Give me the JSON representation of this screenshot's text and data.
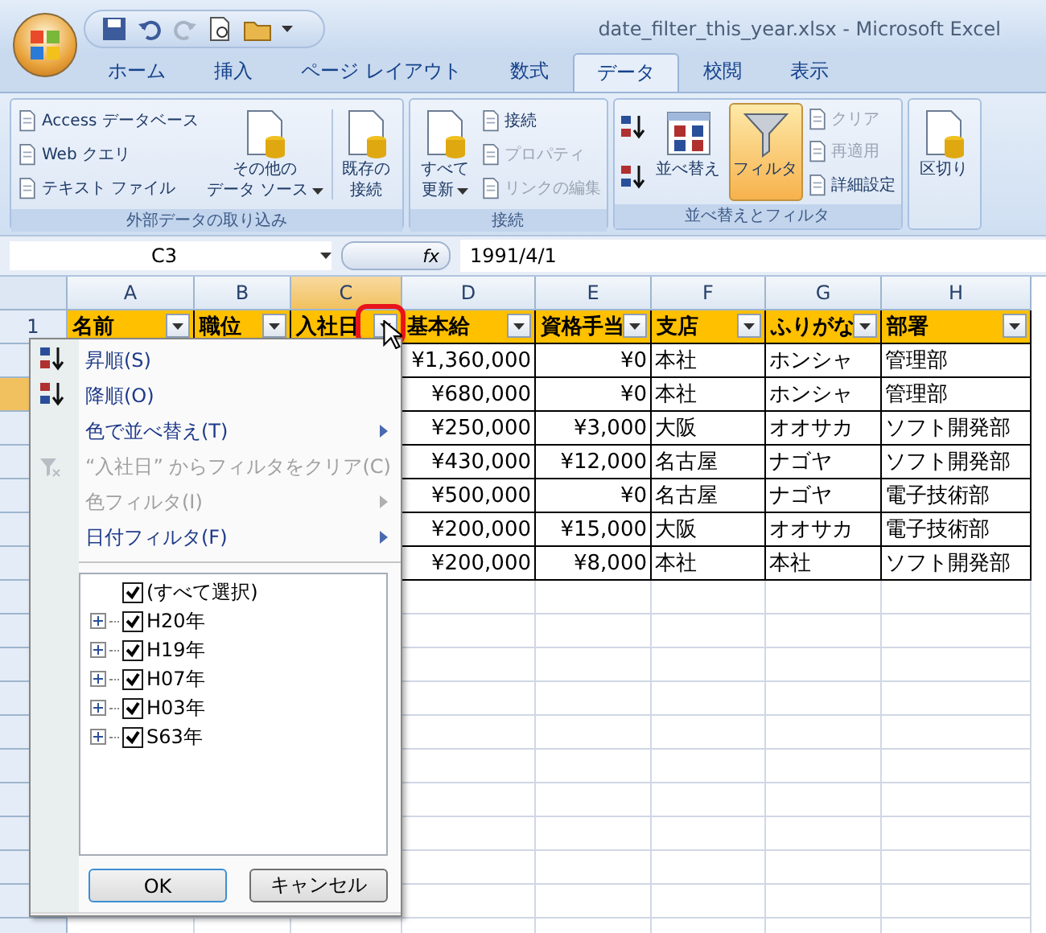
{
  "window": {
    "title": "date_filter_this_year.xlsx - Microsoft Excel"
  },
  "tabs": [
    {
      "label": "ホーム",
      "selected": false
    },
    {
      "label": "挿入",
      "selected": false
    },
    {
      "label": "ページ レイアウト",
      "selected": false
    },
    {
      "label": "数式",
      "selected": false
    },
    {
      "label": "データ",
      "selected": true
    },
    {
      "label": "校閲",
      "selected": false
    },
    {
      "label": "表示",
      "selected": false
    }
  ],
  "ribbon": {
    "groups": [
      {
        "label": "外部データの取り込み",
        "columns": [
          {
            "kind": "stack",
            "items": [
              {
                "label": "Access データベース",
                "disabled": false
              },
              {
                "label": "Web クエリ",
                "disabled": false
              },
              {
                "label": "テキスト ファイル",
                "disabled": false
              }
            ]
          },
          {
            "kind": "large",
            "lines": [
              "その他の",
              "データ ソース"
            ],
            "dropdown": true,
            "pressed": false
          },
          {
            "kind": "separator"
          },
          {
            "kind": "large",
            "lines": [
              "既存の",
              "接続"
            ],
            "dropdown": false,
            "pressed": false
          }
        ]
      },
      {
        "label": "接続",
        "columns": [
          {
            "kind": "large",
            "lines": [
              "すべて",
              "更新"
            ],
            "dropdown": true,
            "pressed": false
          },
          {
            "kind": "stack",
            "items": [
              {
                "label": "接続",
                "disabled": false
              },
              {
                "label": "プロパティ",
                "disabled": true
              },
              {
                "label": "リンクの編集",
                "disabled": true
              }
            ]
          }
        ]
      },
      {
        "label": "並べ替えとフィルタ",
        "columns": [
          {
            "kind": "sorticons"
          },
          {
            "kind": "large",
            "lines": [
              "並べ替え"
            ],
            "dropdown": false,
            "pressed": false
          },
          {
            "kind": "large",
            "lines": [
              "フィルタ"
            ],
            "dropdown": false,
            "pressed": true
          },
          {
            "kind": "stack",
            "items": [
              {
                "label": "クリア",
                "disabled": true
              },
              {
                "label": "再適用",
                "disabled": true
              },
              {
                "label": "詳細設定",
                "disabled": false
              }
            ]
          }
        ]
      },
      {
        "columns": [
          {
            "kind": "large",
            "lines": [
              "区切り"
            ],
            "dropdown": false,
            "pressed": false
          }
        ]
      }
    ]
  },
  "formula_bar": {
    "name_box": "C3",
    "function_label": "fx",
    "value": "1991/4/1"
  },
  "sheet": {
    "columns": [
      {
        "label": "A",
        "selected": false
      },
      {
        "label": "B",
        "selected": false
      },
      {
        "label": "C",
        "selected": true
      },
      {
        "label": "D",
        "selected": false
      },
      {
        "label": "E",
        "selected": false
      },
      {
        "label": "F",
        "selected": false
      },
      {
        "label": "G",
        "selected": false
      },
      {
        "label": "H",
        "selected": false
      }
    ],
    "header_row": {
      "number": "1",
      "cells": [
        "名前",
        "職位",
        "入社日",
        "基本給",
        "資格手当",
        "支店",
        "ふりがな",
        "部署"
      ]
    },
    "rows": [
      {
        "selected": false,
        "cells": [
          "",
          "",
          "",
          "¥1,360,000",
          "¥0",
          "本社",
          "ホンシャ",
          "管理部"
        ]
      },
      {
        "selected": true,
        "cells": [
          "",
          "",
          "",
          "¥680,000",
          "¥0",
          "本社",
          "ホンシャ",
          "管理部"
        ]
      },
      {
        "selected": false,
        "cells": [
          "",
          "",
          "",
          "¥250,000",
          "¥3,000",
          "大阪",
          "オオサカ",
          "ソフト開発部"
        ]
      },
      {
        "selected": false,
        "cells": [
          "",
          "",
          "",
          "¥430,000",
          "¥12,000",
          "名古屋",
          "ナゴヤ",
          "ソフト開発部"
        ]
      },
      {
        "selected": false,
        "cells": [
          "",
          "",
          "",
          "¥500,000",
          "¥0",
          "名古屋",
          "ナゴヤ",
          "電子技術部"
        ]
      },
      {
        "selected": false,
        "cells": [
          "",
          "",
          "",
          "¥200,000",
          "¥15,000",
          "大阪",
          "オオサカ",
          "電子技術部"
        ]
      },
      {
        "selected": false,
        "cells": [
          "",
          "",
          "",
          "¥200,000",
          "¥8,000",
          "本社",
          "本社",
          "ソフト開発部"
        ]
      }
    ]
  },
  "filter_menu": {
    "items": [
      {
        "kind": "sort-asc",
        "label": "昇順(S)",
        "disabled": false,
        "submenu": false
      },
      {
        "kind": "sort-desc",
        "label": "降順(O)",
        "disabled": false,
        "submenu": false
      },
      {
        "kind": "plain",
        "label": "色で並べ替え(T)",
        "disabled": false,
        "submenu": true
      },
      {
        "kind": "clear",
        "label": "“入社日” からフィルタをクリア(C)",
        "disabled": true,
        "submenu": false
      },
      {
        "kind": "plain",
        "label": "色フィルタ(I)",
        "disabled": true,
        "submenu": true
      },
      {
        "kind": "plain",
        "label": "日付フィルタ(F)",
        "disabled": false,
        "submenu": true
      }
    ],
    "tree": {
      "label": "(すべて選択)",
      "checked": true,
      "children": [
        {
          "label": "H20年",
          "checked": true,
          "expanded": false
        },
        {
          "label": "H19年",
          "checked": true,
          "expanded": false
        },
        {
          "label": "H07年",
          "checked": true,
          "expanded": false
        },
        {
          "label": "H03年",
          "checked": true,
          "expanded": false
        },
        {
          "label": "S63年",
          "checked": true,
          "expanded": false
        }
      ]
    },
    "buttons": [
      "OK",
      "キャンセル"
    ]
  }
}
